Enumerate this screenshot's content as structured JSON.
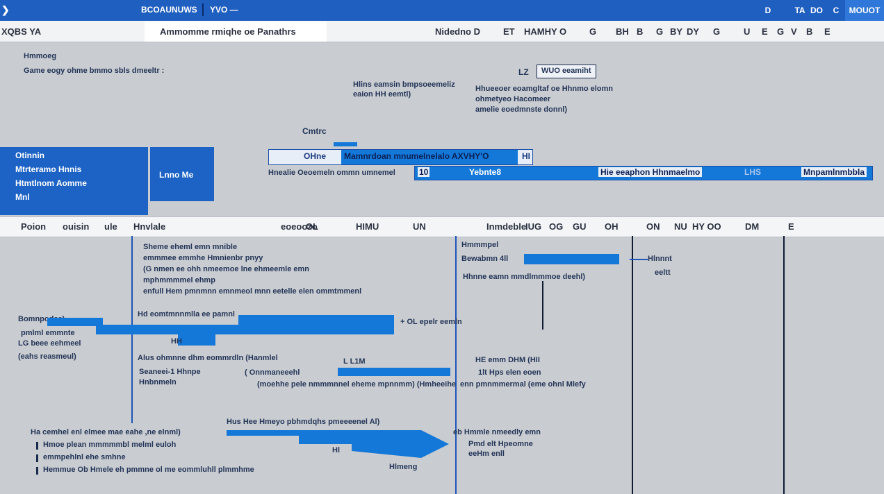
{
  "window": {
    "title": "BCOAUNUWS",
    "subtitle": "YVO —",
    "controls": [
      "D",
      "TA",
      "DO",
      "C",
      "MOUOT"
    ]
  },
  "tabs": {
    "left": "XQBS YA",
    "active": "Ammomme rmiqhe oe Panathrs",
    "right_items": [
      "Nidedno D",
      "ET",
      "HAMHY O",
      "G",
      "BH",
      "B",
      "G",
      "BY",
      "DY",
      "G",
      "U",
      "E",
      "G",
      "V",
      "B",
      "E"
    ]
  },
  "panel_top": {
    "heading": "Hmmoeg",
    "desc": "Game eogy ohme bmmo sbls dmeeltr :",
    "note1_a": "Hlins eamsin bmpsoeemeliz",
    "note1_b": "eaion HH eemtl)",
    "badge_prefix": "LZ",
    "badge": "WUO eeamiht",
    "note2_a": "Hhueeoer eoamgltaf oe Hhnmo elomn",
    "note2_b": "ohmetyeo Hacomeer",
    "note2_c": "amelie eoedmnste donnl)",
    "center_label": "Cmtrc"
  },
  "blue_block": {
    "lines": [
      "Otinnin",
      "Mtrteramo Hnnis",
      "Htmtlnom   Aomme",
      "Mnl"
    ],
    "button": "Lnno Me"
  },
  "fields": {
    "row1_prefix": "OHne",
    "row1_value": "Mamnrdoan mnumelnelalo AXVHY'O",
    "row1_suffix": "HI",
    "row2_label": "Hnealie Oeoemeln ommn umnemel",
    "row2_prefix": "10",
    "row2_value": "Yebnte8",
    "row2_mid": "Hie eeaphon Hhnmaelmo",
    "row2_icon": "LHS",
    "row2_right": "Mnpamlnmbbla"
  },
  "ribbon": [
    "Poion",
    "ouisin",
    "ule",
    "Hnvlale",
    "eoeoozo",
    "OL",
    "HIMU",
    "UN",
    "Inmdeble",
    "IUG",
    "OG",
    "GU",
    "OH",
    "ON",
    "NU",
    "HY OO",
    "DM",
    "E"
  ],
  "lower": {
    "c1_lines": [
      "Sheme eheml emn mnible",
      "emmmee emmhe Hmnienbr pnyy",
      "(G nmen ee ohh nmeemoe lne ehmeemle emn",
      "mphmmmmel ehmp",
      "enfull Hem pmnmnn emnmeol mnn eetelle elen ommtmmenl"
    ],
    "left_label_a": "Bomnpodee)",
    "left_label_b": "pmlml  emmnte",
    "left_label_c": "LG beee eehmeel",
    "left_label_d": "(eahs reasmeul)",
    "arrow_label": "Hd eomtmnnmlla ee pamnl",
    "arrow_sub": "HH",
    "arrow_note": "+ OL epelr eemln",
    "mid_a": "Alus ohmnne dhm eommrdln (Hanmlel",
    "mid_b": "Seaneei-1 Hhnpe",
    "mid_c": "Hnbnmeln",
    "mid_d": "L    L1M",
    "mid_e": "(  Onnmaneeehl",
    "mid_f": "(moehhe pele nmmmnnel eheme mpnnmm)   (Hmheeihe",
    "list_head": "Ha cemhel enl  elmee mae eahe ,ne elnml)",
    "list_items": [
      "Hmoe plean mmmmmbl melml euloh",
      "emmpehlnl ehe smhne",
      "Hemmue Ob Hmele eh  pmmne ol me eommluhll plmmhme"
    ],
    "arrow2_label": "Hus Hee Hmeyo pbhmdqhs pmeeeenel Al)",
    "arrow2_sub": "Hl",
    "arrow2_right_a": "eb Hmmle nmeedly emn",
    "arrow2_right_b": "Pmd elt Hpeomne",
    "arrow2_right_c": "eeHm enll",
    "bottom_mid": "Hlmeng",
    "c3_a": "Hmmmpel",
    "c3_b": "Bewabmn 4ll",
    "c3_c": "Hhnne eamn mmdlmmmoe deehl)",
    "c3_d": "HE emm DHM (HII",
    "c3_e": "1lt  Hps elen eoen",
    "c3_f": "enn pmnmmermal  (eme ohnl Mlefy",
    "c4_a": "Hlnnnt",
    "c4_b": "eeltt"
  }
}
